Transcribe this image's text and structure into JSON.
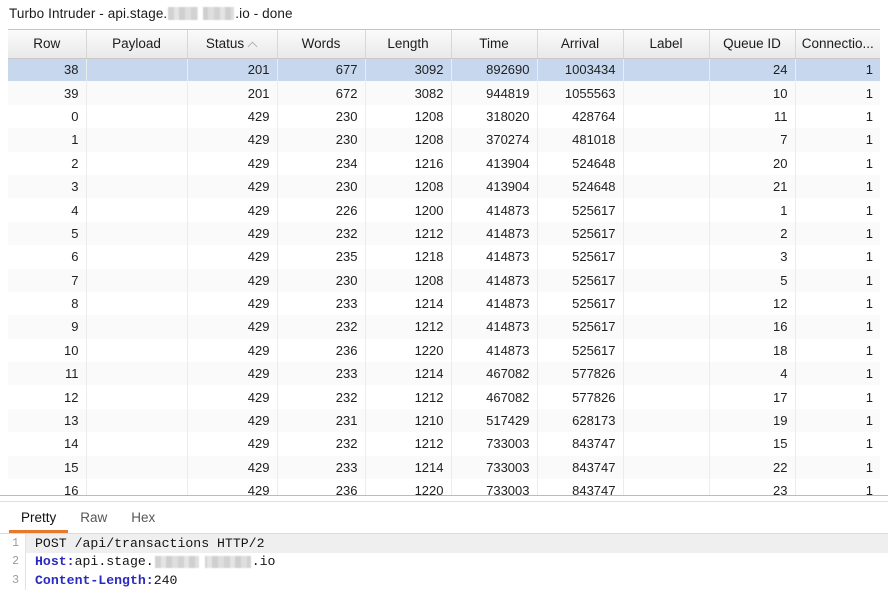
{
  "window": {
    "title_prefix": "Turbo Intruder - api.stage.",
    "title_suffix": ".io - done",
    "redacted": true
  },
  "table": {
    "columns": [
      {
        "label": "Row",
        "sorted": false,
        "width": 78
      },
      {
        "label": "Payload",
        "sorted": false,
        "width": 101
      },
      {
        "label": "Status",
        "sorted": true,
        "sort_dir": "asc",
        "width": 90
      },
      {
        "label": "Words",
        "sorted": false,
        "width": 88
      },
      {
        "label": "Length",
        "sorted": false,
        "width": 86
      },
      {
        "label": "Time",
        "sorted": false,
        "width": 86
      },
      {
        "label": "Arrival",
        "sorted": false,
        "width": 86
      },
      {
        "label": "Label",
        "sorted": false,
        "width": 86
      },
      {
        "label": "Queue ID",
        "sorted": false,
        "width": 86
      },
      {
        "label": "Connectio...",
        "sorted": false,
        "width": 85
      }
    ],
    "selected_row_index": 0,
    "rows": [
      {
        "row": "38",
        "payload": "",
        "status": "201",
        "words": "677",
        "length": "3092",
        "time": "892690",
        "arrival": "1003434",
        "label": "",
        "queue_id": "24",
        "connection": "1"
      },
      {
        "row": "39",
        "payload": "",
        "status": "201",
        "words": "672",
        "length": "3082",
        "time": "944819",
        "arrival": "1055563",
        "label": "",
        "queue_id": "10",
        "connection": "1"
      },
      {
        "row": "0",
        "payload": "",
        "status": "429",
        "words": "230",
        "length": "1208",
        "time": "318020",
        "arrival": "428764",
        "label": "",
        "queue_id": "11",
        "connection": "1"
      },
      {
        "row": "1",
        "payload": "",
        "status": "429",
        "words": "230",
        "length": "1208",
        "time": "370274",
        "arrival": "481018",
        "label": "",
        "queue_id": "7",
        "connection": "1"
      },
      {
        "row": "2",
        "payload": "",
        "status": "429",
        "words": "234",
        "length": "1216",
        "time": "413904",
        "arrival": "524648",
        "label": "",
        "queue_id": "20",
        "connection": "1"
      },
      {
        "row": "3",
        "payload": "",
        "status": "429",
        "words": "230",
        "length": "1208",
        "time": "413904",
        "arrival": "524648",
        "label": "",
        "queue_id": "21",
        "connection": "1"
      },
      {
        "row": "4",
        "payload": "",
        "status": "429",
        "words": "226",
        "length": "1200",
        "time": "414873",
        "arrival": "525617",
        "label": "",
        "queue_id": "1",
        "connection": "1"
      },
      {
        "row": "5",
        "payload": "",
        "status": "429",
        "words": "232",
        "length": "1212",
        "time": "414873",
        "arrival": "525617",
        "label": "",
        "queue_id": "2",
        "connection": "1"
      },
      {
        "row": "6",
        "payload": "",
        "status": "429",
        "words": "235",
        "length": "1218",
        "time": "414873",
        "arrival": "525617",
        "label": "",
        "queue_id": "3",
        "connection": "1"
      },
      {
        "row": "7",
        "payload": "",
        "status": "429",
        "words": "230",
        "length": "1208",
        "time": "414873",
        "arrival": "525617",
        "label": "",
        "queue_id": "5",
        "connection": "1"
      },
      {
        "row": "8",
        "payload": "",
        "status": "429",
        "words": "233",
        "length": "1214",
        "time": "414873",
        "arrival": "525617",
        "label": "",
        "queue_id": "12",
        "connection": "1"
      },
      {
        "row": "9",
        "payload": "",
        "status": "429",
        "words": "232",
        "length": "1212",
        "time": "414873",
        "arrival": "525617",
        "label": "",
        "queue_id": "16",
        "connection": "1"
      },
      {
        "row": "10",
        "payload": "",
        "status": "429",
        "words": "236",
        "length": "1220",
        "time": "414873",
        "arrival": "525617",
        "label": "",
        "queue_id": "18",
        "connection": "1"
      },
      {
        "row": "11",
        "payload": "",
        "status": "429",
        "words": "233",
        "length": "1214",
        "time": "467082",
        "arrival": "577826",
        "label": "",
        "queue_id": "4",
        "connection": "1"
      },
      {
        "row": "12",
        "payload": "",
        "status": "429",
        "words": "232",
        "length": "1212",
        "time": "467082",
        "arrival": "577826",
        "label": "",
        "queue_id": "17",
        "connection": "1"
      },
      {
        "row": "13",
        "payload": "",
        "status": "429",
        "words": "231",
        "length": "1210",
        "time": "517429",
        "arrival": "628173",
        "label": "",
        "queue_id": "19",
        "connection": "1"
      },
      {
        "row": "14",
        "payload": "",
        "status": "429",
        "words": "232",
        "length": "1212",
        "time": "733003",
        "arrival": "843747",
        "label": "",
        "queue_id": "15",
        "connection": "1"
      },
      {
        "row": "15",
        "payload": "",
        "status": "429",
        "words": "233",
        "length": "1214",
        "time": "733003",
        "arrival": "843747",
        "label": "",
        "queue_id": "22",
        "connection": "1"
      },
      {
        "row": "16",
        "payload": "",
        "status": "429",
        "words": "236",
        "length": "1220",
        "time": "733003",
        "arrival": "843747",
        "label": "",
        "queue_id": "23",
        "connection": "1"
      }
    ]
  },
  "message_panel": {
    "tabs": [
      {
        "label": "Pretty",
        "active": true
      },
      {
        "label": "Raw",
        "active": false
      },
      {
        "label": "Hex",
        "active": false
      }
    ],
    "lines": [
      {
        "number": "1",
        "highlight": true,
        "text": "POST /api/transactions HTTP/2"
      },
      {
        "number": "2",
        "highlight": false,
        "header_name": "Host:",
        "value_before": " api.stage.",
        "redacted": true,
        "value_after": ".io"
      },
      {
        "number": "3",
        "highlight": false,
        "header_name": "Content-Length:",
        "value_before": " 240",
        "redacted": false,
        "value_after": ""
      }
    ]
  },
  "colors": {
    "selection": "#c6d7ee",
    "tab_accent": "#e8782b",
    "header_keyword": "#2a2ac0",
    "row_alt": "#fafafa"
  }
}
